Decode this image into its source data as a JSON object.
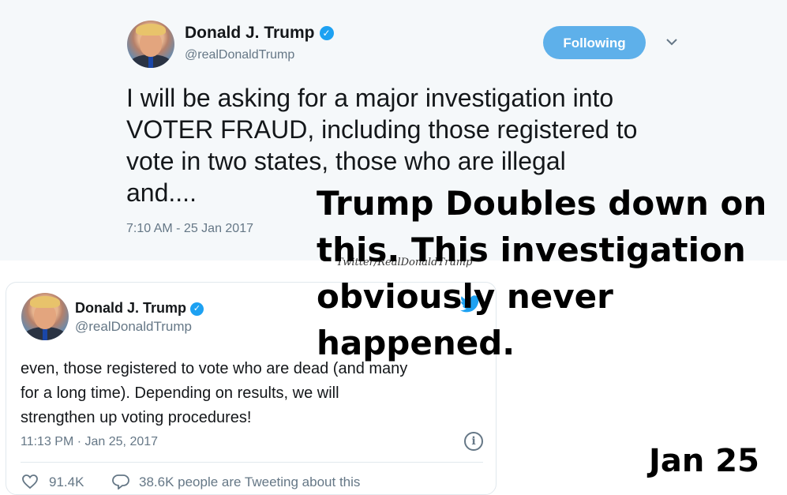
{
  "tweet_top": {
    "author_name": "Donald J. Trump",
    "handle": "@realDonaldTrump",
    "follow_button": "Following",
    "text": "I will be asking for a major investigation into\nVOTER FRAUD, including those registered to\nvote in two states, those who are illegal\nand....",
    "timestamp": "7:10 AM - 25 Jan 2017"
  },
  "tweet_bottom": {
    "author_name": "Donald J. Trump",
    "handle": "@realDonaldTrump",
    "text": "even, those registered to vote who are dead (and many\nfor a long time). Depending on results, we will\nstrengthen up voting procedures!",
    "timestamp": "11:13 PM · Jan 25, 2017",
    "likes": "91.4K",
    "conversation": "38.6K people are Tweeting about this"
  },
  "overlay": {
    "watermark": "Twitter/RealDonaldTrump",
    "headline": "Trump Doubles down on this. This investigation obviously never happened.",
    "date_caption": "Jan 25"
  },
  "colors": {
    "verified": "#1da1f2",
    "follow_button": "#5eb0ea",
    "muted_text": "#657786"
  },
  "icons": [
    "verified-badge-icon",
    "chevron-down-icon",
    "twitter-bird-icon",
    "info-icon",
    "heart-icon",
    "reply-bubble-icon"
  ]
}
